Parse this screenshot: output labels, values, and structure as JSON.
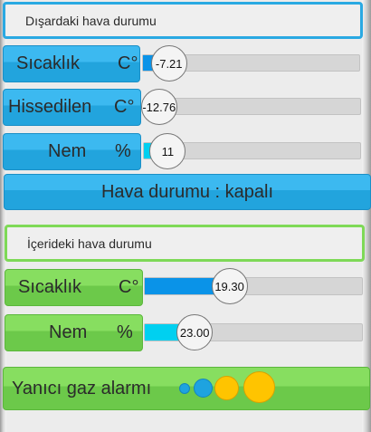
{
  "outdoor": {
    "title": "Dışardaki hava durumu",
    "rows": [
      {
        "label": "Sıcaklık",
        "unit": "C°",
        "value": "-7.21",
        "fraction": 0.07,
        "fill_color": "#0a93e8"
      },
      {
        "label": "Hissedilen",
        "unit": "C°",
        "value": "-12.76",
        "fraction": 0.02,
        "fill_color": "#1a3fd0"
      },
      {
        "label": "Nem",
        "unit": "%",
        "value": "11",
        "fraction": 0.06,
        "fill_color": "#00d0f0"
      }
    ],
    "status": "Hava durumu : kapalı"
  },
  "indoor": {
    "title": "İçerideki  hava durumu",
    "rows": [
      {
        "label": "Sıcaklık",
        "unit": "C°",
        "value": "19.30",
        "fraction": 0.34,
        "fill_color": "#0a93e8"
      },
      {
        "label": "Nem",
        "unit": "%",
        "value": "23.00",
        "fraction": 0.18,
        "fill_color": "#00d0f0"
      }
    ],
    "gas_alarm": "Yanıcı gaz alarmı",
    "alarm_colors": [
      "#1ea3e0",
      "#1ea3e0",
      "#ffc400",
      "#ffc400"
    ]
  }
}
